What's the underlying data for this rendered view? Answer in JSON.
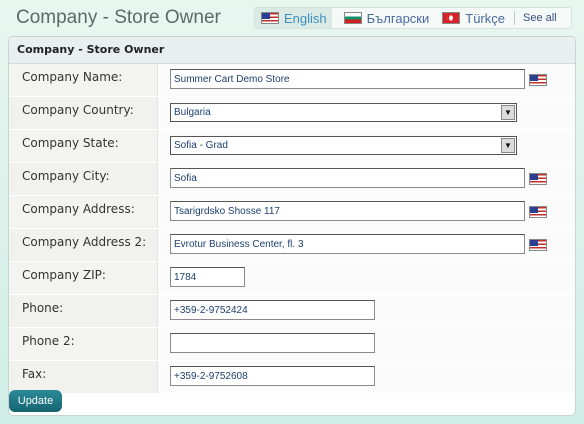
{
  "header": {
    "title": "Company - Store Owner"
  },
  "languages": [
    {
      "label": "English",
      "flag": "us-flag-icon",
      "active": true
    },
    {
      "label": "Български",
      "flag": "bg-flag-icon",
      "active": false
    },
    {
      "label": "Türkçe",
      "flag": "tr-flag-icon",
      "active": false
    }
  ],
  "see_all": "See all",
  "panel": {
    "title": "Company - Store Owner"
  },
  "fields": [
    {
      "label": "Company Name:",
      "value": "Summer Cart Demo Store",
      "type": "text",
      "flag": true
    },
    {
      "label": "Company Country:",
      "value": "Bulgaria",
      "type": "select"
    },
    {
      "label": "Company State:",
      "value": "Sofia - Grad",
      "type": "select"
    },
    {
      "label": "Company City:",
      "value": "Sofia",
      "type": "text",
      "flag": true
    },
    {
      "label": "Company Address:",
      "value": "Tsarigrdsko Shosse 117",
      "type": "text",
      "flag": true
    },
    {
      "label": "Company Address 2:",
      "value": "Evrotur Business Center, fl. 3",
      "type": "text",
      "flag": true
    },
    {
      "label": "Company ZIP:",
      "value": "1784",
      "type": "text"
    },
    {
      "label": "Phone:",
      "value": "+359-2-9752424",
      "type": "text"
    },
    {
      "label": "Phone 2:",
      "value": "",
      "type": "text"
    },
    {
      "label": "Fax:",
      "value": "+359-2-9752608",
      "type": "text"
    }
  ],
  "update_label": "Update"
}
